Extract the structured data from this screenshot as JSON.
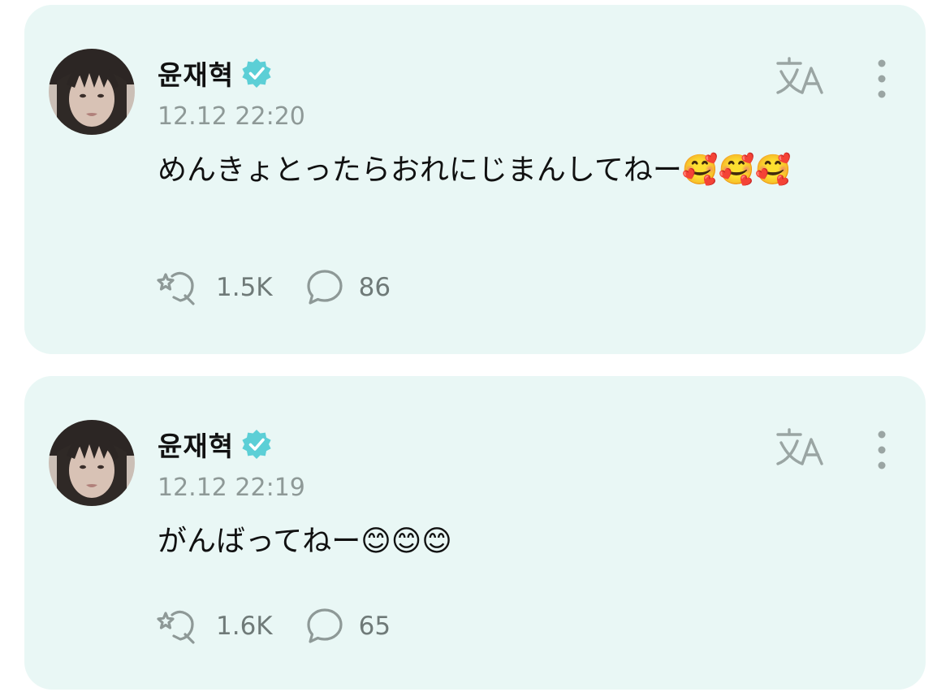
{
  "posts": [
    {
      "author": "윤재혁",
      "verified": true,
      "timestamp": "12.12 22:20",
      "body": "めんきょとったらおれにじまんしてねー🥰🥰🥰",
      "likes": "1.5K",
      "comments": "86"
    },
    {
      "author": "윤재혁",
      "verified": true,
      "timestamp": "12.12 22:19",
      "body": "がんばってねー😊😊😊",
      "likes": "1.6K",
      "comments": "65"
    }
  ],
  "icons": {
    "verified": "verified-check-icon",
    "translate": "translate-icon",
    "more": "vertical-dots-icon",
    "like": "sparkle-heart-icon",
    "comment": "speech-bubble-icon"
  },
  "colors": {
    "card_background": "#e9f7f5",
    "verified_badge": "#5ccfd6",
    "icon_gray": "#8e9997",
    "text_primary": "#111111"
  }
}
